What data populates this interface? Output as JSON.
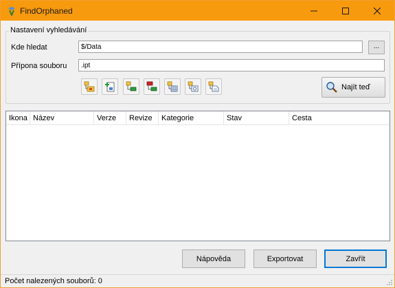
{
  "window": {
    "title": "FindOrphaned",
    "icon": "app-icon",
    "minimize_icon": "minimize-icon",
    "maximize_icon": "maximize-icon",
    "close_icon": "close-icon",
    "titlebar_color": "#f89a0e"
  },
  "search": {
    "group_title": "Nastavení vyhledávání",
    "where_label": "Kde hledat",
    "where_value": "$/Data",
    "browse_label": "...",
    "ext_label": "Přípona souboru",
    "ext_value": ".ipt",
    "search_button_label": "Najít teď",
    "toolbar_icons": [
      "folder-part-icon",
      "new-part-icon",
      "assembly-green-icon",
      "assembly-red-icon",
      "drawing-grid-icon",
      "drawing-sheet-icon",
      "drawing-doc-icon"
    ]
  },
  "results": {
    "columns": [
      "Ikona",
      "Název",
      "Verze",
      "Revize",
      "Kategorie",
      "Stav",
      "Cesta"
    ],
    "rows": []
  },
  "footer": {
    "help_label": "Nápověda",
    "export_label": "Exportovat",
    "close_label": "Zavřít"
  },
  "status": {
    "text": "Počet nalezených souborů: 0"
  }
}
